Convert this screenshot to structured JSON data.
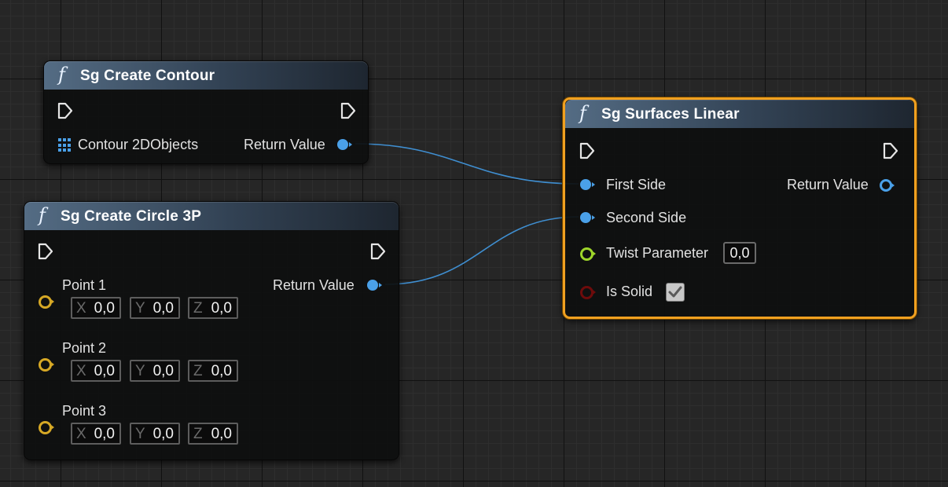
{
  "nodes": {
    "create_contour": {
      "title": "Sg Create Contour",
      "inputs": {
        "contour_label": "Contour 2DObjects"
      },
      "outputs": {
        "return_label": "Return Value"
      }
    },
    "create_circle": {
      "title": "Sg Create Circle 3P",
      "outputs": {
        "return_label": "Return Value"
      },
      "points": [
        {
          "label": "Point 1",
          "x": "0,0",
          "y": "0,0",
          "z": "0,0"
        },
        {
          "label": "Point 2",
          "x": "0,0",
          "y": "0,0",
          "z": "0,0"
        },
        {
          "label": "Point 3",
          "x": "0,0",
          "y": "0,0",
          "z": "0,0"
        }
      ]
    },
    "surfaces_linear": {
      "title": "Sg Surfaces Linear",
      "selected": true,
      "inputs": {
        "first_side_label": "First Side",
        "second_side_label": "Second Side",
        "twist_label": "Twist Parameter",
        "twist_value": "0,0",
        "is_solid_label": "Is Solid",
        "is_solid_checked": true
      },
      "outputs": {
        "return_label": "Return Value"
      }
    }
  },
  "axis_labels": {
    "x": "X",
    "y": "Y",
    "z": "Z"
  },
  "function_icon_glyph": "f",
  "colors": {
    "object_pin": "#4aa0e8",
    "vector_pin": "#d6a825",
    "float_pin": "#9ed52a",
    "bool_pin": "#6e0b0b",
    "selection_outline": "#f0a020",
    "header_gradient_start": "#546c84"
  },
  "icons": {
    "function": "function-f-icon",
    "exec": "exec-arrow-icon",
    "array": "array-grid-icon",
    "check": "checkmark-icon"
  }
}
